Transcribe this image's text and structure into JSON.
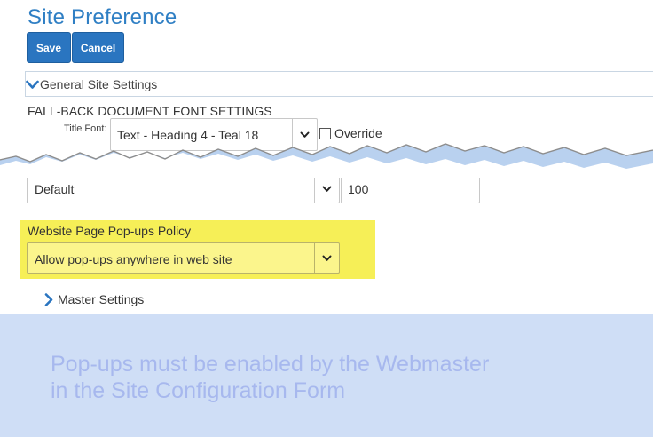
{
  "page": {
    "title": "Site Preference"
  },
  "toolbar": {
    "save_label": "Save",
    "cancel_label": "Cancel"
  },
  "general_section": {
    "label": "General Site Settings",
    "expanded": true
  },
  "font_settings": {
    "heading": "FALL-BACK DOCUMENT FONT SETTINGS",
    "title_font_label": "Title Font:",
    "title_font_value": "Text - Heading 4 - Teal 18",
    "override_label": "Override",
    "override_checked": false,
    "font_family_value": "Default",
    "font_size_value": "100"
  },
  "popups": {
    "label": "Website Page Pop-ups Policy",
    "value": "Allow pop-ups anywhere in web site"
  },
  "master_section": {
    "label": "Master Settings",
    "expanded": false
  },
  "note": {
    "line1": "Pop-ups must be enabled by the Webmaster",
    "line2": "in the Site Configuration Form"
  },
  "colors": {
    "accent": "#2a75c0",
    "title": "#2f7fc4",
    "highlight": "#f6ef57",
    "note_bg": "#cfdef6",
    "note_text": "#a7b8ee"
  }
}
